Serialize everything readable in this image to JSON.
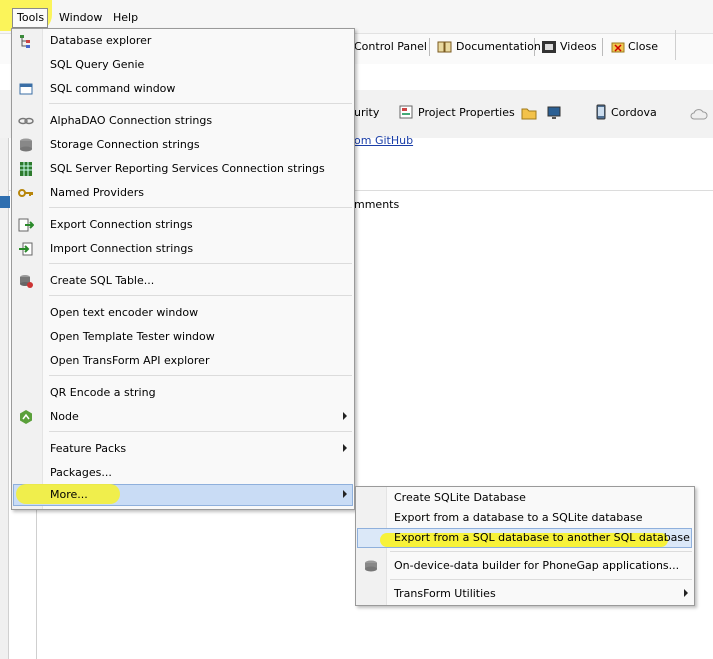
{
  "menubar": {
    "tools": "Tools",
    "window": "Window",
    "help": "Help"
  },
  "toolbar": {
    "control_panel": "Control Panel",
    "documentation": "Documentation",
    "videos": "Videos",
    "close": "Close"
  },
  "secondary": {
    "urity": "urity",
    "project_properties": "Project Properties",
    "cordova": "Cordova",
    "github_link": "om GitHub",
    "mments": "mments"
  },
  "menu": {
    "items": [
      "Database explorer",
      "SQL Query Genie",
      "SQL command window",
      "AlphaDAO Connection strings",
      "Storage Connection strings",
      "SQL Server Reporting Services Connection strings",
      "Named Providers",
      "Export Connection strings",
      "Import Connection strings",
      "Create SQL Table...",
      "Open text encoder window",
      "Open Template Tester window",
      "Open TransForm API explorer",
      "QR Encode a string",
      "Node",
      "Feature Packs",
      "Packages...",
      "More..."
    ]
  },
  "submenu": {
    "items": [
      "Create SQLite Database",
      "Export from a database to a SQLite database",
      "Export from a SQL database to another SQL database",
      "On-device-data builder for PhoneGap applications...",
      "TransForm Utilities"
    ]
  },
  "colors": {
    "highlight": "#f4ef3a",
    "selection": "#c9dcf5",
    "link": "#1a3ea8"
  }
}
